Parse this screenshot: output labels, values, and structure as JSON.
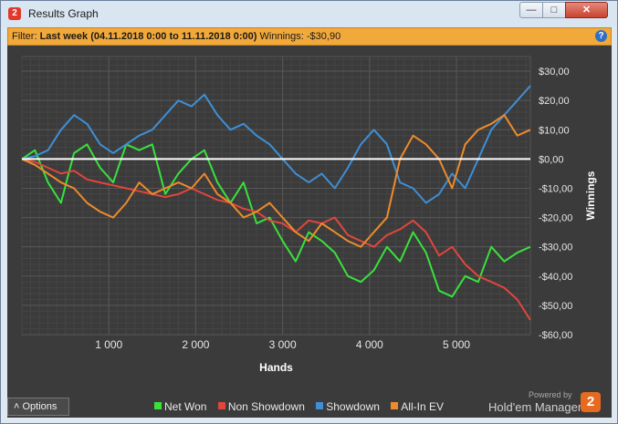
{
  "window": {
    "title": "Results Graph",
    "app_icon": "2",
    "min_glyph": "—",
    "max_glyph": "□",
    "close_glyph": "✕"
  },
  "filter": {
    "prefix": "Filter:",
    "range": "Last week (04.11.2018 0:00 to 11.11.2018 0:00)",
    "winnings_label": "Winnings:",
    "winnings_value": "-$30,90",
    "help_glyph": "?"
  },
  "options": {
    "label": "Options",
    "caret": "˄"
  },
  "powered_by": {
    "line1": "Powered by",
    "brand": "Hold'em Manager",
    "badge": "2"
  },
  "colors": {
    "net_won": "#39e13c",
    "non_showdown": "#e0463c",
    "showdown": "#3d8fd6",
    "allin_ev": "#ee8a2c",
    "plot_bg": "#3b3b3b",
    "grid": "#4c4c4c",
    "zero_line": "#ffffff"
  },
  "chart_data": {
    "type": "line",
    "xlabel": "Hands",
    "ylabel": "Winnings",
    "xlim": [
      0,
      5850
    ],
    "ylim": [
      -60,
      35
    ],
    "x_ticks": [
      1000,
      2000,
      3000,
      4000,
      5000
    ],
    "x_tick_labels": [
      "1 000",
      "2 000",
      "3 000",
      "4 000",
      "5 000"
    ],
    "y_ticks": [
      30,
      20,
      10,
      0,
      -10,
      -20,
      -30,
      -40,
      -50,
      -60
    ],
    "y_tick_labels": [
      "$30,00",
      "$20,00",
      "$10,00",
      "$0,00",
      "-$10,00",
      "-$20,00",
      "-$30,00",
      "-$40,00",
      "-$50,00",
      "-$60,00"
    ],
    "legend_position": "bottom",
    "series": [
      {
        "name": "Net Won",
        "color": "#39e13c",
        "x": [
          0,
          150,
          300,
          450,
          600,
          750,
          900,
          1050,
          1200,
          1350,
          1500,
          1650,
          1800,
          1950,
          2100,
          2250,
          2400,
          2550,
          2700,
          2850,
          3000,
          3150,
          3300,
          3450,
          3600,
          3750,
          3900,
          4050,
          4200,
          4350,
          4500,
          4650,
          4800,
          4950,
          5100,
          5250,
          5400,
          5550,
          5700,
          5850
        ],
        "y": [
          0,
          3,
          -8,
          -15,
          2,
          5,
          -3,
          -8,
          5,
          3,
          5,
          -12,
          -5,
          0,
          3,
          -8,
          -15,
          -8,
          -22,
          -20,
          -28,
          -35,
          -25,
          -28,
          -32,
          -40,
          -42,
          -38,
          -30,
          -35,
          -25,
          -32,
          -45,
          -47,
          -40,
          -42,
          -30,
          -35,
          -32,
          -30
        ]
      },
      {
        "name": "Non Showdown",
        "color": "#e0463c",
        "x": [
          0,
          150,
          300,
          450,
          600,
          750,
          900,
          1050,
          1200,
          1350,
          1500,
          1650,
          1800,
          1950,
          2100,
          2250,
          2400,
          2550,
          2700,
          2850,
          3000,
          3150,
          3300,
          3450,
          3600,
          3750,
          3900,
          4050,
          4200,
          4350,
          4500,
          4650,
          4800,
          4950,
          5100,
          5250,
          5400,
          5550,
          5700,
          5850
        ],
        "y": [
          0,
          -1,
          -3,
          -5,
          -4,
          -7,
          -8,
          -9,
          -10,
          -11,
          -12,
          -13,
          -12,
          -10,
          -12,
          -14,
          -15,
          -17,
          -18,
          -21,
          -22,
          -25,
          -21,
          -22,
          -20,
          -26,
          -28,
          -30,
          -26,
          -24,
          -21,
          -25,
          -33,
          -30,
          -36,
          -40,
          -42,
          -44,
          -48,
          -55
        ]
      },
      {
        "name": "Showdown",
        "color": "#3d8fd6",
        "x": [
          0,
          150,
          300,
          450,
          600,
          750,
          900,
          1050,
          1200,
          1350,
          1500,
          1650,
          1800,
          1950,
          2100,
          2250,
          2400,
          2550,
          2700,
          2850,
          3000,
          3150,
          3300,
          3450,
          3600,
          3750,
          3900,
          4050,
          4200,
          4350,
          4500,
          4650,
          4800,
          4950,
          5100,
          5250,
          5400,
          5550,
          5700,
          5850
        ],
        "y": [
          0,
          1,
          3,
          10,
          15,
          12,
          5,
          2,
          5,
          8,
          10,
          15,
          20,
          18,
          22,
          15,
          10,
          12,
          8,
          5,
          0,
          -5,
          -8,
          -5,
          -10,
          -3,
          5,
          10,
          5,
          -8,
          -10,
          -15,
          -12,
          -5,
          -10,
          0,
          10,
          15,
          20,
          25
        ]
      },
      {
        "name": "All-In EV",
        "color": "#ee8a2c",
        "x": [
          0,
          150,
          300,
          450,
          600,
          750,
          900,
          1050,
          1200,
          1350,
          1500,
          1650,
          1800,
          1950,
          2100,
          2250,
          2400,
          2550,
          2700,
          2850,
          3000,
          3150,
          3300,
          3450,
          3600,
          3750,
          3900,
          4050,
          4200,
          4350,
          4500,
          4650,
          4800,
          4950,
          5100,
          5250,
          5400,
          5550,
          5700,
          5850
        ],
        "y": [
          0,
          -2,
          -5,
          -8,
          -10,
          -15,
          -18,
          -20,
          -15,
          -8,
          -12,
          -10,
          -8,
          -10,
          -5,
          -12,
          -15,
          -20,
          -18,
          -15,
          -20,
          -25,
          -28,
          -22,
          -25,
          -28,
          -30,
          -25,
          -20,
          0,
          8,
          5,
          0,
          -10,
          5,
          10,
          12,
          15,
          8,
          10
        ]
      }
    ]
  }
}
